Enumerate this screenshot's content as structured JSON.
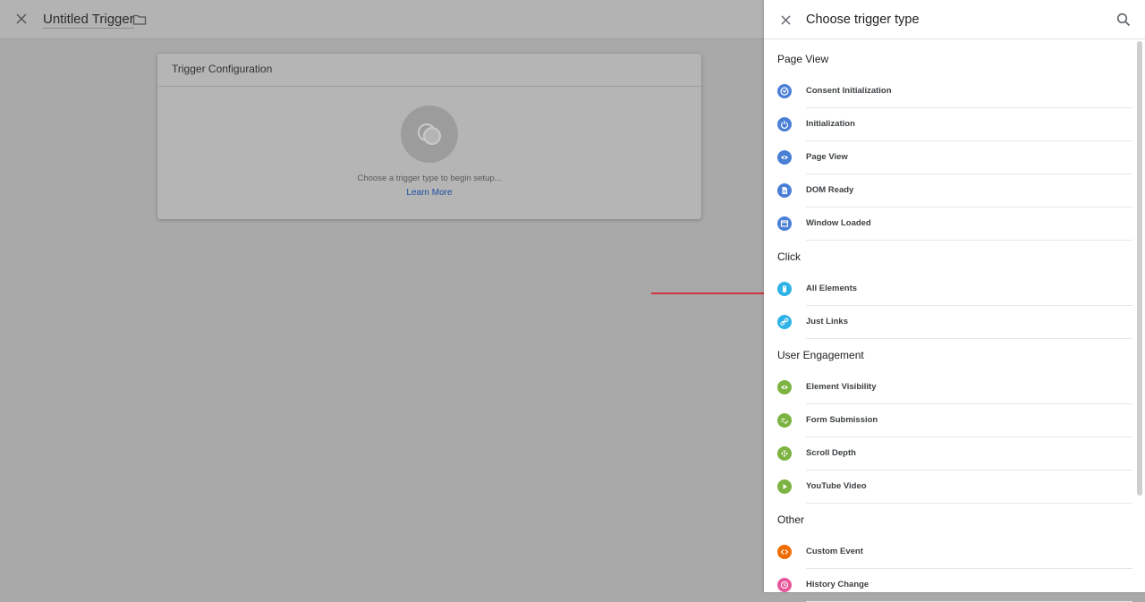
{
  "editor": {
    "title": "Untitled Trigger",
    "card_title": "Trigger Configuration",
    "hint": "Choose a trigger type to begin setup...",
    "learn_more": "Learn More"
  },
  "panel": {
    "title": "Choose trigger type",
    "sections": [
      {
        "title": "Page View",
        "items": [
          {
            "label": "Consent Initialization",
            "icon": "consent-icon",
            "color": "#4a7fd6"
          },
          {
            "label": "Initialization",
            "icon": "power-icon",
            "color": "#4a7fd6"
          },
          {
            "label": "Page View",
            "icon": "eye-icon",
            "color": "#4a7fd6"
          },
          {
            "label": "DOM Ready",
            "icon": "document-icon",
            "color": "#4a7fd6"
          },
          {
            "label": "Window Loaded",
            "icon": "window-icon",
            "color": "#4a7fd6"
          }
        ]
      },
      {
        "title": "Click",
        "items": [
          {
            "label": "All Elements",
            "icon": "mouse-icon",
            "color": "#2fb3e6"
          },
          {
            "label": "Just Links",
            "icon": "link-icon",
            "color": "#2fb3e6"
          }
        ]
      },
      {
        "title": "User Engagement",
        "items": [
          {
            "label": "Element Visibility",
            "icon": "eye-icon",
            "color": "#7cb342"
          },
          {
            "label": "Form Submission",
            "icon": "form-icon",
            "color": "#7cb342"
          },
          {
            "label": "Scroll Depth",
            "icon": "scroll-icon",
            "color": "#7cb342"
          },
          {
            "label": "YouTube Video",
            "icon": "play-icon",
            "color": "#7cb342"
          }
        ]
      },
      {
        "title": "Other",
        "items": [
          {
            "label": "Custom Event",
            "icon": "code-icon",
            "color": "#ef6c00"
          },
          {
            "label": "History Change",
            "icon": "history-icon",
            "color": "#e8579a"
          }
        ]
      }
    ]
  },
  "annotation": {
    "arrow_color": "#d9232e"
  }
}
